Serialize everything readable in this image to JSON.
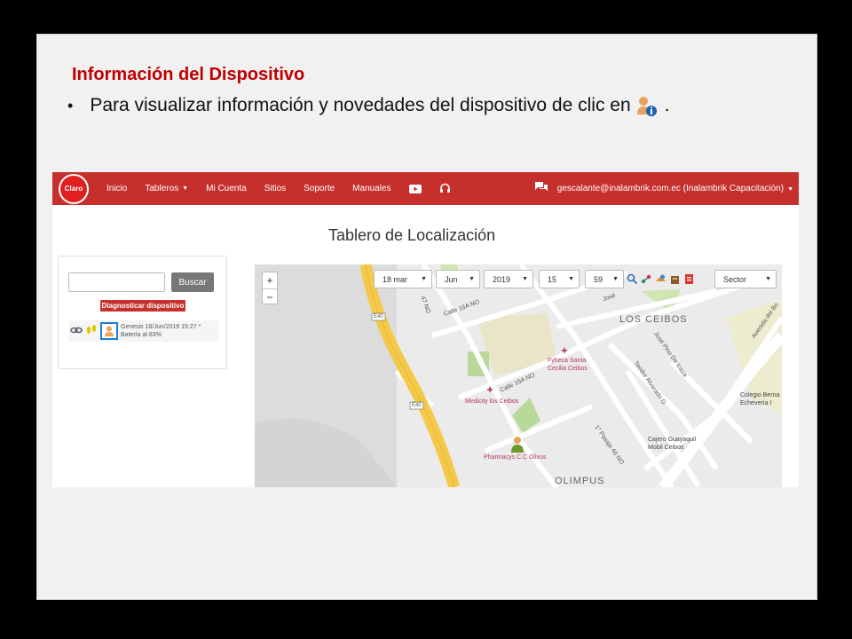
{
  "slide": {
    "title": "Información del Dispositivo",
    "bullet": "•",
    "instruction_text": "Para visualizar información y novedades del dispositivo de clic en",
    "instruction_end": ".",
    "inline_icon": "user-info-icon"
  },
  "app": {
    "logo_text": "Claro",
    "nav": {
      "items": [
        "Inicio",
        "Tableros",
        "Mi Cuenta",
        "Sitios",
        "Soporte",
        "Manuales"
      ],
      "user": "gescalante@inalambrik.com.ec (Inalambrik Capacitación)",
      "icons": [
        "youtube-icon",
        "headset-icon",
        "chat-icon"
      ],
      "color": "#c6302c"
    },
    "board_title": "Tablero de Localización",
    "search": {
      "value": "",
      "button": "Buscar"
    },
    "diagnose_button": "Diagnosticar dispositivo",
    "device": {
      "line1": "Genesis 18/Jun/2019 15:27 *",
      "line2": "Batería al 83%",
      "icons": [
        "link-icon",
        "footprints-icon",
        "user-info-icon"
      ]
    },
    "map": {
      "zoom_in": "+",
      "zoom_out": "−",
      "controls": {
        "day": "18 mar",
        "month": "Jun",
        "year": "2019",
        "hour": "15",
        "minute": "59",
        "sector": "Sector"
      },
      "tool_icons": [
        "search-icon",
        "route-icon",
        "layers-icon",
        "building-icon",
        "pdf-icon"
      ],
      "labels": {
        "ceibos": "LOS CEIBOS",
        "olimpus": "OLIMPUS",
        "calle16a": "Calle 16A NO",
        "calle15a": "Calle 15A NO",
        "fybeca": "Fybeca Santa\nCecilia Ceibos",
        "medicity": "Medicity los Ceibos",
        "pharmacys": "Pharmacys C.C Olivos",
        "jose_pino": "José Pino De Icaza",
        "teodor": "Teodor Alvarado G",
        "pasaje": "1° Pasaje 46 NO",
        "cajero": "Cajero Guayaquil\nMobil Ceibos",
        "colegio": "Colegio Berna\nEchevería I",
        "avenida": "Avenida del Bo",
        "e40a": "E40",
        "e40b": "E40",
        "jose_top": "José",
        "num47": "47 NO"
      }
    }
  }
}
